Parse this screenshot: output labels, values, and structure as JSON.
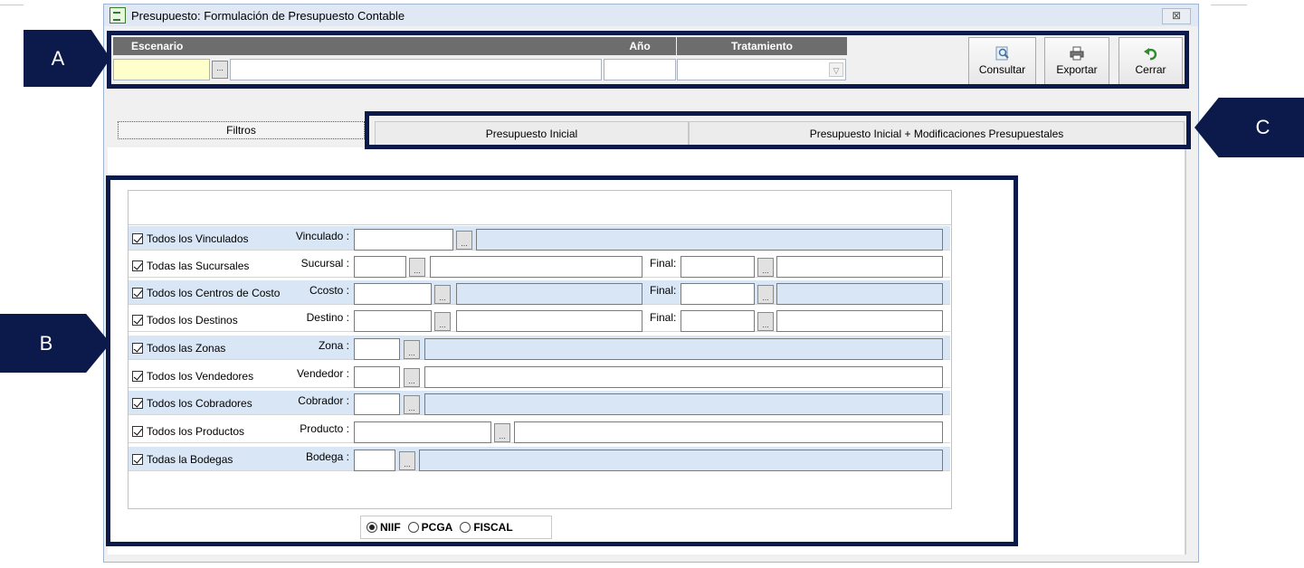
{
  "window": {
    "title": "Presupuesto: Formulación de Presupuesto Contable",
    "close": "⊠"
  },
  "callouts": {
    "a": "A",
    "b": "B",
    "c": "C"
  },
  "header": {
    "escenario": "Escenario",
    "anio": "Año",
    "tratamiento": "Tratamiento",
    "dots": "..."
  },
  "toolbar": {
    "consultar": "Consultar",
    "exportar": "Exportar",
    "cerrar": "Cerrar"
  },
  "tabs": {
    "filtros": "Filtros",
    "inicial": "Presupuesto Inicial",
    "modificaciones": "Presupuesto Inicial + Modificaciones Presupuestales"
  },
  "filters": [
    {
      "check": "Todos los Vinculados",
      "label": "Vinculado :"
    },
    {
      "check": "Todas las Sucursales",
      "label": "Sucursal :",
      "final": "Final:"
    },
    {
      "check": "Todos los Centros de Costo",
      "label": "Ccosto :",
      "final": "Final:"
    },
    {
      "check": "Todos los Destinos",
      "label": "Destino :",
      "final": "Final:"
    },
    {
      "check": "Todos las Zonas",
      "label": "Zona :"
    },
    {
      "check": "Todos los Vendedores",
      "label": "Vendedor :"
    },
    {
      "check": "Todos los Cobradores",
      "label": "Cobrador :"
    },
    {
      "check": "Todos los Productos",
      "label": "Producto :"
    },
    {
      "check": "Todas la Bodegas",
      "label": "Bodega :"
    }
  ],
  "dots": "...",
  "radios": {
    "niif": "NIIF",
    "pcga": "PCGA",
    "fiscal": "FISCAL",
    "selected": "NIIF"
  }
}
